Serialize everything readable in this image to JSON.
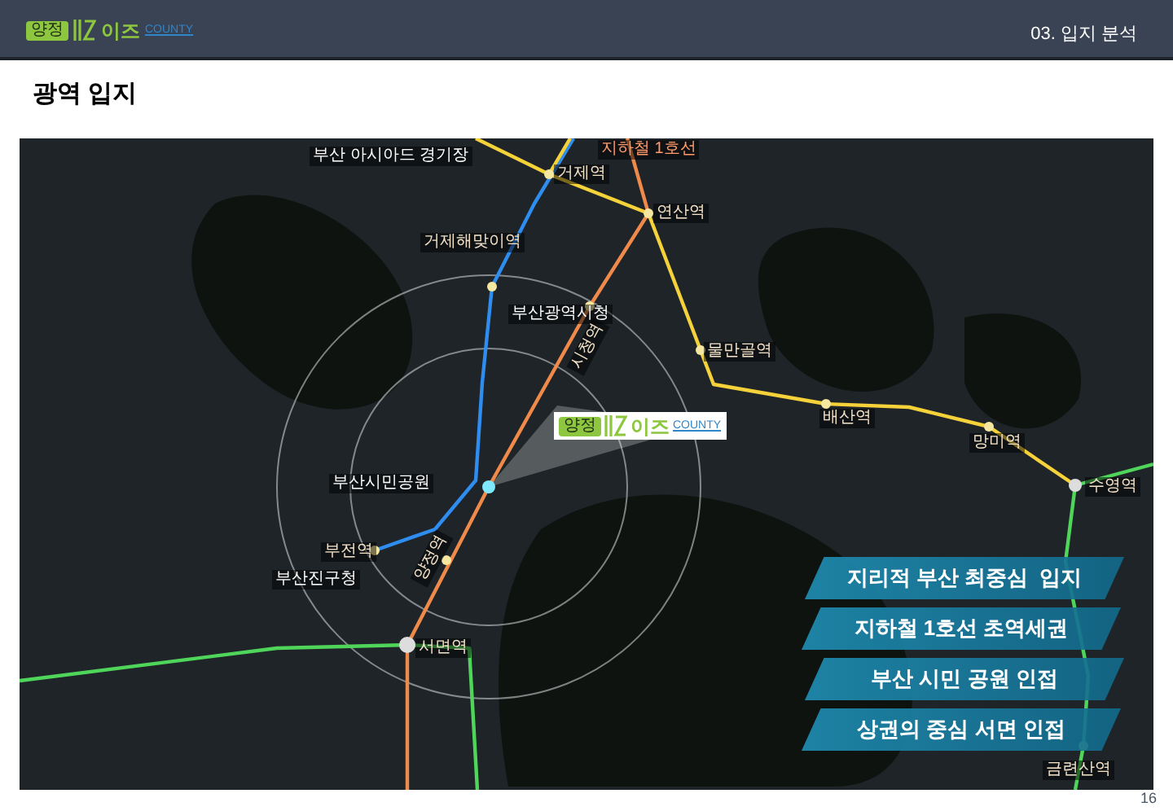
{
  "header": {
    "logo": {
      "badge": "양정",
      "name": "이즈",
      "sub": "COUNTY"
    },
    "section": "03. 입지 분석"
  },
  "title": "광역 입지",
  "map": {
    "labels": [
      {
        "kind": "place",
        "text": "부산 아시아드 경기장"
      },
      {
        "kind": "line",
        "text": "지하철 1호선"
      },
      {
        "kind": "station",
        "text": "거제역"
      },
      {
        "kind": "station",
        "text": "연산역"
      },
      {
        "kind": "station",
        "text": "거제해맞이역"
      },
      {
        "kind": "place",
        "text": "부산광역시청"
      },
      {
        "kind": "station",
        "text": "시청역"
      },
      {
        "kind": "station",
        "text": "물만골역"
      },
      {
        "kind": "station",
        "text": "배산역"
      },
      {
        "kind": "station",
        "text": "망미역"
      },
      {
        "kind": "station",
        "text": "수영역"
      },
      {
        "kind": "place",
        "text": "부산시민공원"
      },
      {
        "kind": "station",
        "text": "부전역"
      },
      {
        "kind": "place",
        "text": "부산진구청"
      },
      {
        "kind": "station",
        "text": "양정역"
      },
      {
        "kind": "station",
        "text": "서면역"
      },
      {
        "kind": "station",
        "text": "금련산역"
      }
    ],
    "site_label": {
      "badge": "양정",
      "name": "이즈",
      "sub": "COUNTY"
    },
    "callouts": [
      "지리적 부산 최중심  입지",
      "지하철 1호선 초역세권",
      "부산 시민 공원 인접",
      "상권의 중심 서면 인접"
    ]
  },
  "page_number": "16"
}
